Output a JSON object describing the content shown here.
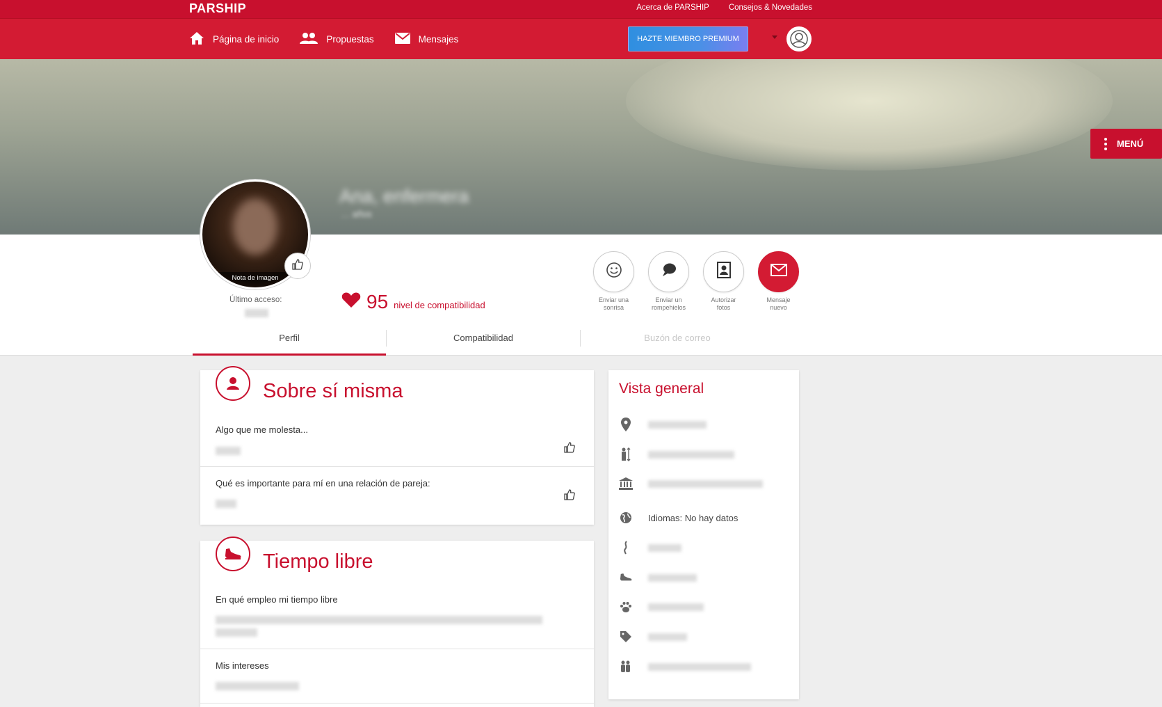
{
  "header": {
    "logo": "PARSHIP",
    "top_links": [
      "Acerca de PARSHIP",
      "Consejos & Novedades"
    ],
    "nav": [
      {
        "label": "Página de inicio",
        "icon": "home-icon"
      },
      {
        "label": "Propuestas",
        "icon": "people-icon"
      },
      {
        "label": "Mensajes",
        "icon": "mail-icon"
      }
    ],
    "premium_label": "HAZTE MIEMBRO PREMIUM",
    "user_icon": "user-avatar-icon"
  },
  "banner": {
    "menu_label": "MENÚ",
    "name": "Ana, enfermera",
    "age": "… años"
  },
  "profile": {
    "photo_note": "Nota de imagen",
    "last_access_label": "Último acceso:",
    "compat_value": "95",
    "compat_label": "nivel de compatibilidad",
    "actions": [
      {
        "label_1": "Enviar una",
        "label_2": "sonrisa",
        "icon": "smile-icon"
      },
      {
        "label_1": "Enviar un",
        "label_2": "rompehielos",
        "icon": "chat-bubble-icon"
      },
      {
        "label_1": "Autorizar",
        "label_2": "fotos",
        "icon": "photo-icon"
      },
      {
        "label_1": "Mensaje",
        "label_2": "nuevo",
        "icon": "envelope-icon"
      }
    ],
    "tabs": [
      "Perfil",
      "Compatibilidad",
      "Buzón de correo"
    ]
  },
  "about": {
    "title": "Sobre sí misma",
    "q1": "Algo que me molesta...",
    "q2": "Qué es importante para mí en una relación de pareja:"
  },
  "freetime": {
    "title": "Tiempo libre",
    "q1": "En qué empleo mi tiempo libre",
    "q2": "Mis intereses"
  },
  "overview": {
    "title": "Vista general",
    "languages": "Idiomas: No hay datos",
    "icons": [
      "location-pin-icon",
      "height-icon",
      "education-icon",
      "globe-icon",
      "smoking-icon",
      "sport-shoe-icon",
      "paw-icon",
      "tag-icon",
      "family-icon"
    ]
  },
  "colors": {
    "brand_red": "#c8102e",
    "premium_blue": "#2f8fe0"
  }
}
